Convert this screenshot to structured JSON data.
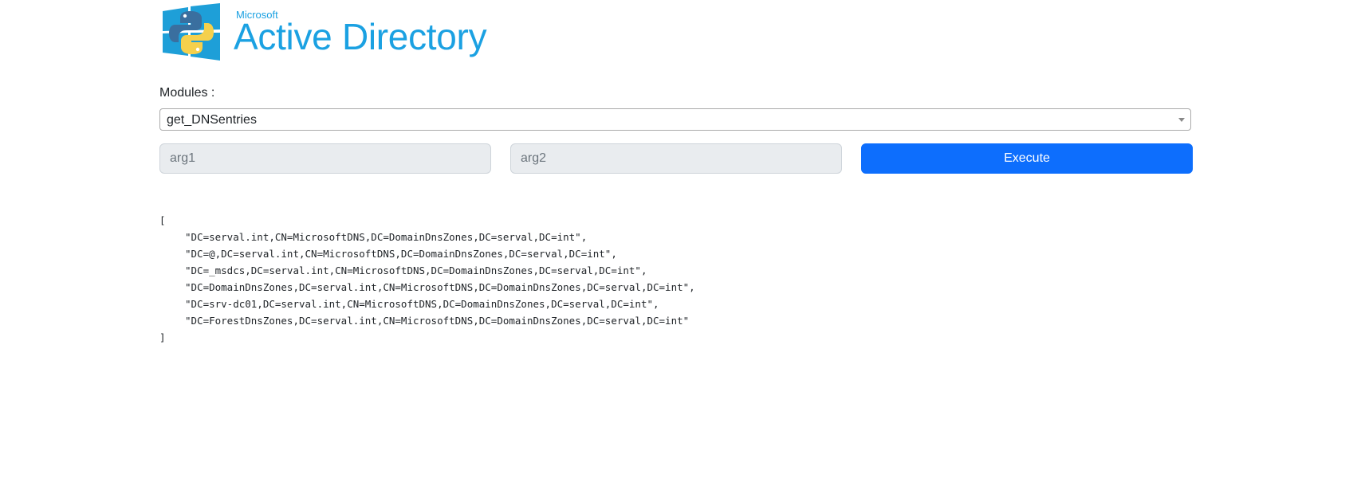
{
  "header": {
    "logo_icon": "python-windows-logo-icon",
    "brand_small": "Microsoft",
    "brand_title": "Active Directory",
    "brand_color": "#1ba1e2"
  },
  "form": {
    "modules_label": "Modules :",
    "module_selected": "get_DNSentries",
    "arg1_placeholder": "arg1",
    "arg2_placeholder": "arg2",
    "execute_label": "Execute",
    "execute_color": "#0d6efd"
  },
  "output": {
    "open_bracket": "[",
    "lines": [
      "\"DC=serval.int,CN=MicrosoftDNS,DC=DomainDnsZones,DC=serval,DC=int\",",
      "\"DC=@,DC=serval.int,CN=MicrosoftDNS,DC=DomainDnsZones,DC=serval,DC=int\",",
      "\"DC=_msdcs,DC=serval.int,CN=MicrosoftDNS,DC=DomainDnsZones,DC=serval,DC=int\",",
      "\"DC=DomainDnsZones,DC=serval.int,CN=MicrosoftDNS,DC=DomainDnsZones,DC=serval,DC=int\",",
      "\"DC=srv-dc01,DC=serval.int,CN=MicrosoftDNS,DC=DomainDnsZones,DC=serval,DC=int\",",
      "\"DC=ForestDnsZones,DC=serval.int,CN=MicrosoftDNS,DC=DomainDnsZones,DC=serval,DC=int\""
    ],
    "close_bracket": "]"
  }
}
